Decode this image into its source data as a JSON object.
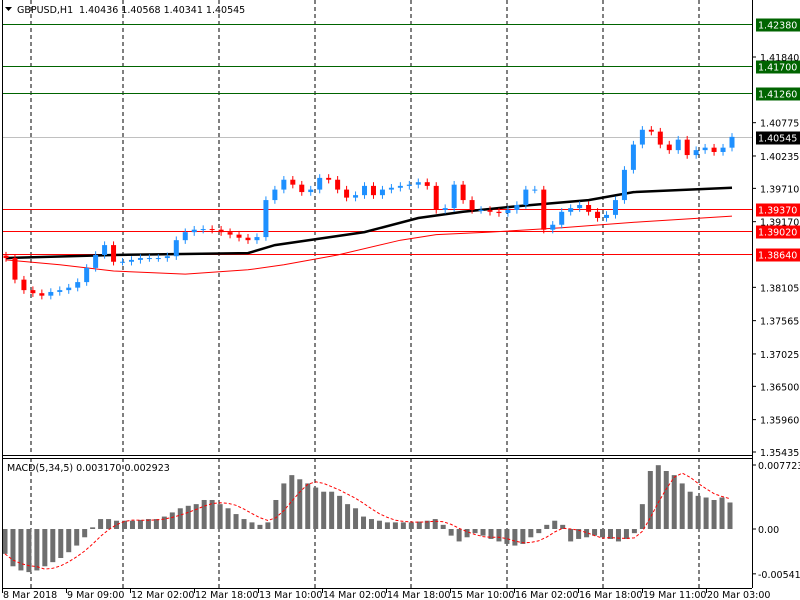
{
  "header": {
    "symbol_label": "GBPUSD,H1",
    "ohlc": "1.40436 1.40568 1.40341 1.40545"
  },
  "macd_header": {
    "label": "MACD(5,34,5) 0.003170 0.002923"
  },
  "colors": {
    "bull": "#1e90ff",
    "bear": "#ff0000",
    "resistance": "#006400",
    "support": "#ff0000",
    "current": "#000000",
    "ma_slow": "#000000",
    "ma_red": "#ff0000",
    "histogram": "#6e6e6e"
  },
  "chart_data": [
    {
      "type": "candlestick",
      "title": "GBPUSD,H1",
      "ylim": [
        1.35435,
        1.4268
      ],
      "y_ticks": [
        "1.41840",
        "1.40775",
        "1.40235",
        "1.39710",
        "1.39170",
        "1.38105",
        "1.37565",
        "1.37025",
        "1.36500",
        "1.35960",
        "1.35435"
      ],
      "x_ticks": [
        "8 Mar 2018",
        "9 Mar 09:00",
        "12 Mar 02:00",
        "12 Mar 18:00",
        "13 Mar 10:00",
        "14 Mar 02:00",
        "14 Mar 18:00",
        "15 Mar 10:00",
        "16 Mar 02:00",
        "16 Mar 18:00",
        "19 Mar 11:00",
        "20 Mar 03:00"
      ],
      "closes": [
        1.3858,
        1.3823,
        1.3806,
        1.3801,
        1.3797,
        1.3803,
        1.3806,
        1.381,
        1.3819,
        1.3842,
        1.3863,
        1.3879,
        1.3852,
        1.3852,
        1.3855,
        1.3858,
        1.3858,
        1.3858,
        1.3861,
        1.3887,
        1.39,
        1.3904,
        1.3905,
        1.3904,
        1.39,
        1.3896,
        1.3891,
        1.3887,
        1.3892,
        1.3952,
        1.3969,
        1.3985,
        1.3977,
        1.3965,
        1.3969,
        1.3988,
        1.3985,
        1.3969,
        1.3956,
        1.396,
        1.3975,
        1.396,
        1.3969,
        1.3972,
        1.3975,
        1.3977,
        1.3981,
        1.3975,
        1.3936,
        1.3939,
        1.3977,
        1.3952,
        1.3936,
        1.3936,
        1.3933,
        1.3931,
        1.3936,
        1.3944,
        1.3969,
        1.3969,
        1.3904,
        1.3912,
        1.3933,
        1.3939,
        1.3944,
        1.3933,
        1.3923,
        1.3928,
        1.3952,
        1.4001,
        1.4042,
        1.4066,
        1.4063,
        1.4042,
        1.4033,
        1.405,
        1.4025,
        1.4033,
        1.4037,
        1.403,
        1.4037,
        1.40545
      ],
      "ma_black": [
        [
          0,
          1.3858
        ],
        [
          12,
          1.3863
        ],
        [
          27,
          1.3866
        ],
        [
          30,
          1.3879
        ],
        [
          40,
          1.39
        ],
        [
          46,
          1.3923
        ],
        [
          51,
          1.3933
        ],
        [
          57,
          1.3942
        ],
        [
          65,
          1.3952
        ],
        [
          70,
          1.3965
        ],
        [
          81,
          1.3972
        ]
      ],
      "ma_red": [
        [
          0,
          1.3855
        ],
        [
          6,
          1.3847
        ],
        [
          12,
          1.3837
        ],
        [
          20,
          1.3832
        ],
        [
          27,
          1.3839
        ],
        [
          31,
          1.3847
        ],
        [
          37,
          1.3863
        ],
        [
          44,
          1.3887
        ],
        [
          48,
          1.3896
        ],
        [
          54,
          1.39
        ],
        [
          62,
          1.3907
        ],
        [
          71,
          1.3917
        ],
        [
          81,
          1.3926
        ]
      ],
      "levels": [
        {
          "price": "1.42380",
          "kind": "resistance"
        },
        {
          "price": "1.41700",
          "kind": "resistance"
        },
        {
          "price": "1.41260",
          "kind": "resistance"
        },
        {
          "price": "1.40545",
          "kind": "current"
        },
        {
          "price": "1.39370",
          "kind": "support"
        },
        {
          "price": "1.39020",
          "kind": "support"
        },
        {
          "price": "1.38640",
          "kind": "support"
        }
      ]
    },
    {
      "type": "bar",
      "title": "MACD(5,34,5)",
      "ylim": [
        -0.00541,
        0.007723
      ],
      "y_ticks": [
        "0.007723",
        "0.00",
        "-0.00541"
      ],
      "main_value": 0.00317,
      "signal_value": 0.002923,
      "histogram": [
        -0.003,
        -0.0045,
        -0.005,
        -0.0052,
        -0.005,
        -0.0045,
        -0.004,
        -0.0035,
        -0.0028,
        -0.002,
        -0.001,
        0.0002,
        0.0012,
        0.0012,
        0.001,
        0.001,
        0.001,
        0.0011,
        0.0012,
        0.0012,
        0.0015,
        0.002,
        0.0025,
        0.0028,
        0.003,
        0.0035,
        0.0035,
        0.003,
        0.0025,
        0.0018,
        0.0012,
        0.0008,
        0.0005,
        0.0008,
        0.0035,
        0.0055,
        0.0065,
        0.006,
        0.0055,
        0.005,
        0.0045,
        0.0045,
        0.004,
        0.003,
        0.0025,
        0.0015,
        0.0012,
        0.001,
        0.0008,
        0.0008,
        0.0008,
        0.0008,
        0.0009,
        0.001,
        0.0012,
        0.0005,
        -0.0008,
        -0.0015,
        -0.001,
        -0.0005,
        -0.0008,
        -0.0012,
        -0.0015,
        -0.0018,
        -0.002,
        -0.0018,
        -0.001,
        -0.0005,
        0.0005,
        0.001,
        0.0005,
        -0.0015,
        -0.0012,
        -0.001,
        -0.0008,
        -0.001,
        -0.0012,
        -0.0015,
        -0.0012,
        -0.0005,
        0.003,
        0.007,
        0.0077,
        0.007,
        0.0065,
        0.0055,
        0.0045,
        0.004,
        0.0038,
        0.0035,
        0.0038,
        0.0032
      ]
    }
  ]
}
